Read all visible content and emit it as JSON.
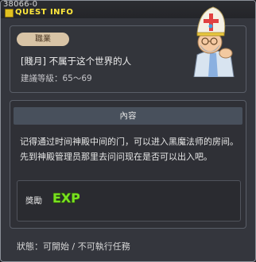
{
  "header": {
    "quest_id": "38066-0",
    "title": "QUEST INFO"
  },
  "job_panel": {
    "badge": "職業",
    "quest_name": "[賤月] 不属于这个世界的人",
    "level_range": "建議等級：65～69"
  },
  "content_panel": {
    "heading": "內容",
    "description": "记得通过时间神殿中间的门，可以进入黑魔法师的房间。先到神殿管理员那里去问问现在是否可以出入吧。",
    "reward_label": "獎勵",
    "reward_icon_text": "EXP"
  },
  "status": "狀態：可開始 / 不可執行任務",
  "icons": {
    "title_icon": "quest-square-icon",
    "npc": "npc-priest-portrait",
    "reward": "exp-icon"
  },
  "colors": {
    "title": "#ffe83c",
    "badge_bg": "#d8c4a6",
    "exp_green": "#78e020"
  }
}
